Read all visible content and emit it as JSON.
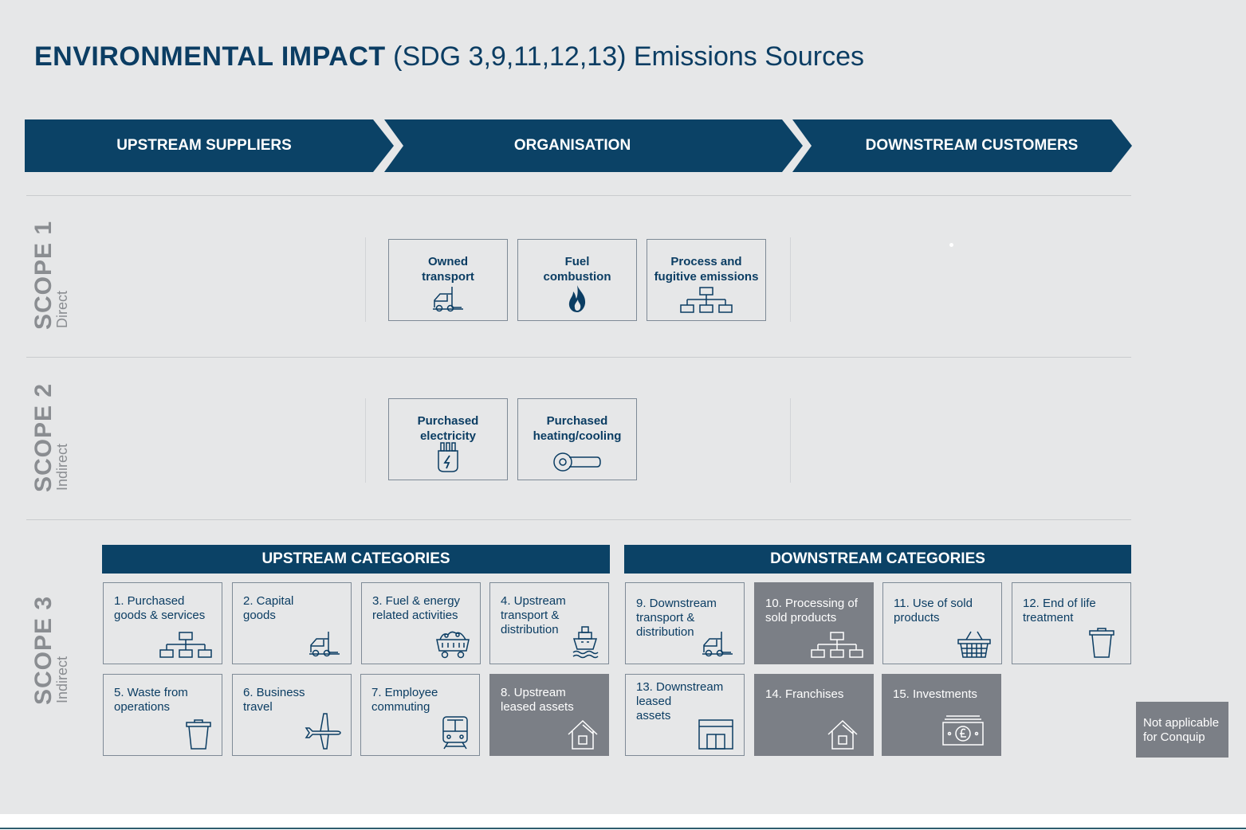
{
  "title": {
    "bold": "ENVIRONMENTAL IMPACT",
    "rest": "(SDG 3,9,11,12,13) Emissions Sources"
  },
  "stages": [
    {
      "label": "UPSTREAM SUPPLIERS"
    },
    {
      "label": "ORGANISATION"
    },
    {
      "label": "DOWNSTREAM CUSTOMERS"
    }
  ],
  "colors": {
    "navy": "#0b4266",
    "grey_na": "#7b7f86",
    "background": "#e6e7e8"
  },
  "scopes": [
    {
      "name": "SCOPE 1",
      "sub": "Direct",
      "items": [
        {
          "label": "Owned\ntransport",
          "icon": "van-icon"
        },
        {
          "label": "Fuel\ncombustion",
          "icon": "flame-icon"
        },
        {
          "label": "Process and\nfugitive emissions",
          "icon": "hierarchy-icon"
        }
      ]
    },
    {
      "name": "SCOPE 2",
      "sub": "Indirect",
      "items": [
        {
          "label": "Purchased\nelectricity",
          "icon": "plug-icon"
        },
        {
          "label": "Purchased\nheating/cooling",
          "icon": "heating-pipe-icon"
        }
      ]
    },
    {
      "name": "SCOPE 3",
      "sub": "Indirect"
    }
  ],
  "upstream_categories": {
    "title": "UPSTREAM CATEGORIES",
    "items": [
      {
        "label": "1. Purchased\ngoods & services",
        "icon": "hierarchy-icon",
        "applicable": true
      },
      {
        "label": "2. Capital\ngoods",
        "icon": "van-icon",
        "applicable": true
      },
      {
        "label": "3. Fuel & energy\nrelated activities",
        "icon": "mine-cart-icon",
        "applicable": true
      },
      {
        "label": "4. Upstream\ntransport &\ndistribution",
        "icon": "ship-icon",
        "applicable": true
      },
      {
        "label": "5. Waste from\noperations",
        "icon": "bin-icon",
        "applicable": true
      },
      {
        "label": "6. Business\ntravel",
        "icon": "plane-icon",
        "applicable": true
      },
      {
        "label": "7. Employee\ncommuting",
        "icon": "train-icon",
        "applicable": true
      },
      {
        "label": "8. Upstream\nleased assets",
        "icon": "house-icon",
        "applicable": false
      }
    ]
  },
  "downstream_categories": {
    "title": "DOWNSTREAM CATEGORIES",
    "items": [
      {
        "label": "9. Downstream\ntransport &\ndistribution",
        "icon": "van-icon",
        "applicable": true
      },
      {
        "label": "10. Processing of\nsold products",
        "icon": "hierarchy-icon",
        "applicable": false
      },
      {
        "label": "11. Use of sold\nproducts",
        "icon": "basket-icon",
        "applicable": true
      },
      {
        "label": "12. End of life\ntreatment",
        "icon": "bin-icon",
        "applicable": true
      },
      {
        "label": "13. Downstream\nleased\nassets",
        "icon": "storefront-icon",
        "applicable": true
      },
      {
        "label": "14. Franchises",
        "icon": "house-icon",
        "applicable": false
      },
      {
        "label": "15. Investments",
        "icon": "banknote-icon",
        "applicable": false
      }
    ]
  },
  "legend": {
    "label": "Not applicable\nfor Conquip"
  }
}
